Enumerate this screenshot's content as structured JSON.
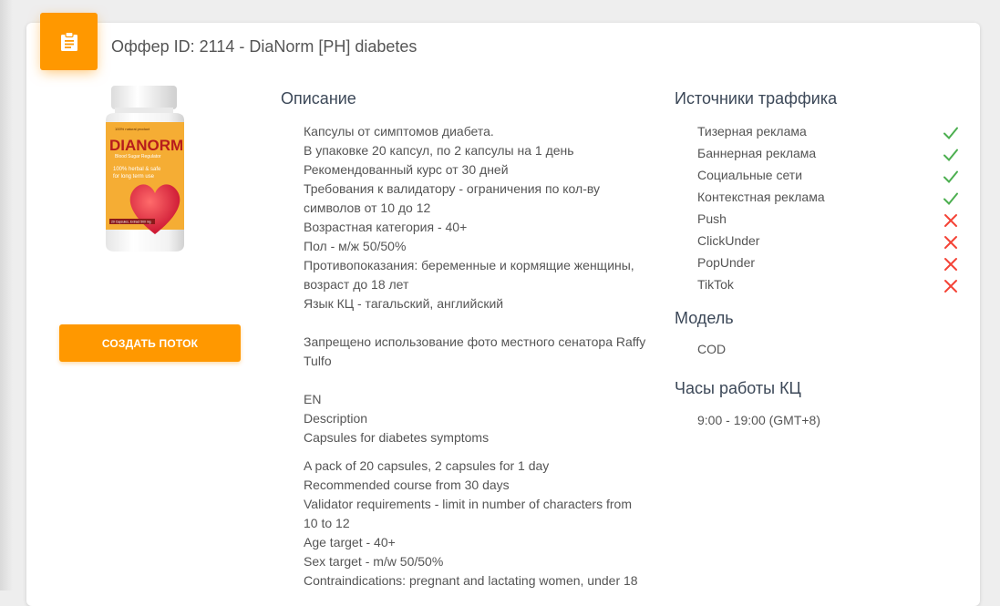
{
  "offer": {
    "title": "Оффер ID: 2114 - DiaNorm [PH] diabetes",
    "icon": "clipboard-icon",
    "create_flow_label": "СОЗДАТЬ ПОТОК",
    "product_image": {
      "brand": "DIANORM",
      "tagline": "Blood Sugar Regulator",
      "claim_line1": "100% herbal & safe",
      "claim_line2": "for long term use",
      "footer": "20 Capsules, Extract 500 mg",
      "top_note": "100% natural product"
    }
  },
  "description": {
    "title": "Описание",
    "lines": [
      "Капсулы от симптомов диабета.",
      "В упаковке 20 капсул, по 2 капсулы на 1 день",
      "Рекомендованный курс от 30 дней",
      "Требования к валидатору - ограничения по кол-ву",
      "символов от 10 до 12",
      "Возрастная категория - 40+",
      "Пол - м/ж 50/50%",
      "Противопоказания: беременные и кормящие женщины,",
      "возраст до 18 лет",
      "Язык КЦ - тагальский, английский",
      "Запрещено использование фото местного сенатора Raffy",
      "Tulfo",
      "EN",
      "Description",
      "Capsules for diabetes symptoms",
      "A pack of 20 capsules, 2 capsules for 1 day",
      "Recommended course from 30 days",
      "Validator requirements - limit in number of characters from",
      "10 to 12",
      "Age target - 40+",
      "Sex target - m/w 50/50%",
      "Contraindications: pregnant and lactating women, under 18"
    ]
  },
  "traffic": {
    "title": "Источники траффика",
    "sources": [
      {
        "label": "Тизерная реклама",
        "allowed": true
      },
      {
        "label": "Баннерная реклама",
        "allowed": true
      },
      {
        "label": "Социальные сети",
        "allowed": true
      },
      {
        "label": "Контекстная реклама",
        "allowed": true
      },
      {
        "label": "Push",
        "allowed": false
      },
      {
        "label": "ClickUnder",
        "allowed": false
      },
      {
        "label": "PopUnder",
        "allowed": false
      },
      {
        "label": "TikTok",
        "allowed": false
      }
    ]
  },
  "model": {
    "title": "Модель",
    "value": "COD"
  },
  "call_center": {
    "title": "Часы работы КЦ",
    "value": "9:00 - 19:00 (GMT+8)"
  },
  "colors": {
    "accent": "#ff9800",
    "allowed": "#4caf50",
    "denied": "#f44336"
  }
}
